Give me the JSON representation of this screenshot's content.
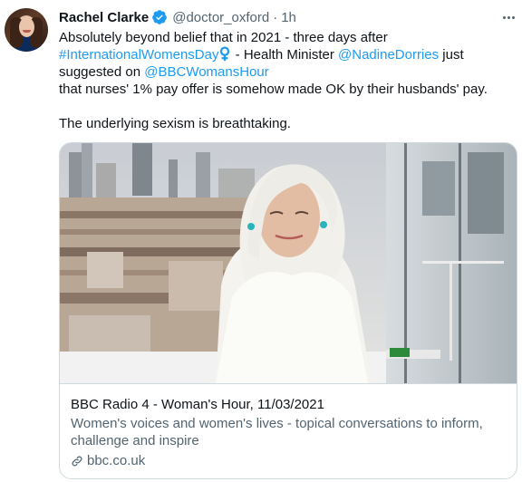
{
  "tweet": {
    "author_name": "Rachel Clarke",
    "handle": "@doctor_oxford",
    "separator": "·",
    "time": "1h",
    "verified": true,
    "icons": {
      "verified": "verified-badge-icon",
      "more": "more-options-icon",
      "venus": "female-sign-icon",
      "link": "link-icon"
    },
    "text": {
      "line1": "Absolutely beyond belief that in 2021 - three days after",
      "hashtag": "#InternationalWomensDay",
      "seg2": " - Health Minister ",
      "mention1": "@NadineDorries",
      "seg3": " just suggested on ",
      "mention2": "@BBCWomansHour",
      "seg4": "that nurses' 1% pay offer is somehow made OK by their husbands' pay.",
      "line_last": "The underlying sexism is breathtaking."
    }
  },
  "card": {
    "title": "BBC Radio 4 - Woman's Hour, 11/03/2021",
    "description": "Women's voices and women's lives - topical conversations to inform, challenge and inspire",
    "domain": "bbc.co.uk"
  },
  "colors": {
    "link": "#1d9bf0",
    "secondary": "#536471",
    "border": "#cfd9de",
    "venus": "#1d9bf0"
  }
}
